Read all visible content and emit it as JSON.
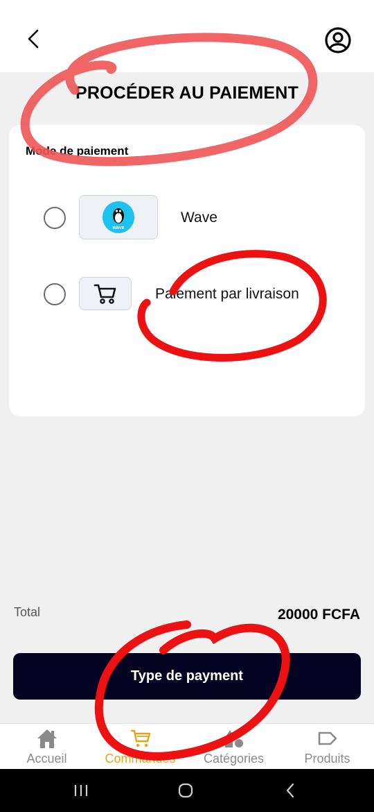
{
  "header": {
    "back_icon": "chevron-left-icon",
    "profile_icon": "user-circle-icon"
  },
  "page_title": "PROCÉDER AU PAIEMENT",
  "payment_card": {
    "heading": "Mode de paiement",
    "options": [
      {
        "label": "Wave",
        "icon": "wave-logo-icon",
        "selected": false
      },
      {
        "label": "Paiement par livraison",
        "icon": "cart-icon",
        "selected": false
      }
    ]
  },
  "summary": {
    "total_label": "Total",
    "total_value": "20000 FCFA"
  },
  "pay_button": {
    "label": "Type de payment"
  },
  "bottom_nav": {
    "items": [
      {
        "label": "Accueil",
        "icon": "home-icon",
        "active": false
      },
      {
        "label": "Commandes",
        "icon": "cart-icon",
        "active": true
      },
      {
        "label": "Catégories",
        "icon": "shapes-icon",
        "active": false
      },
      {
        "label": "Produits",
        "icon": "tag-icon",
        "active": false
      }
    ]
  },
  "system_nav": {
    "buttons": [
      "recents-icon",
      "home-circle-icon",
      "back-icon"
    ]
  },
  "colors": {
    "background": "#f1f0f1",
    "primary_button": "#050322",
    "active_nav": "#e8a21a",
    "wave_blue": "#1dc3f0",
    "annotation_red": "#ee1111"
  }
}
